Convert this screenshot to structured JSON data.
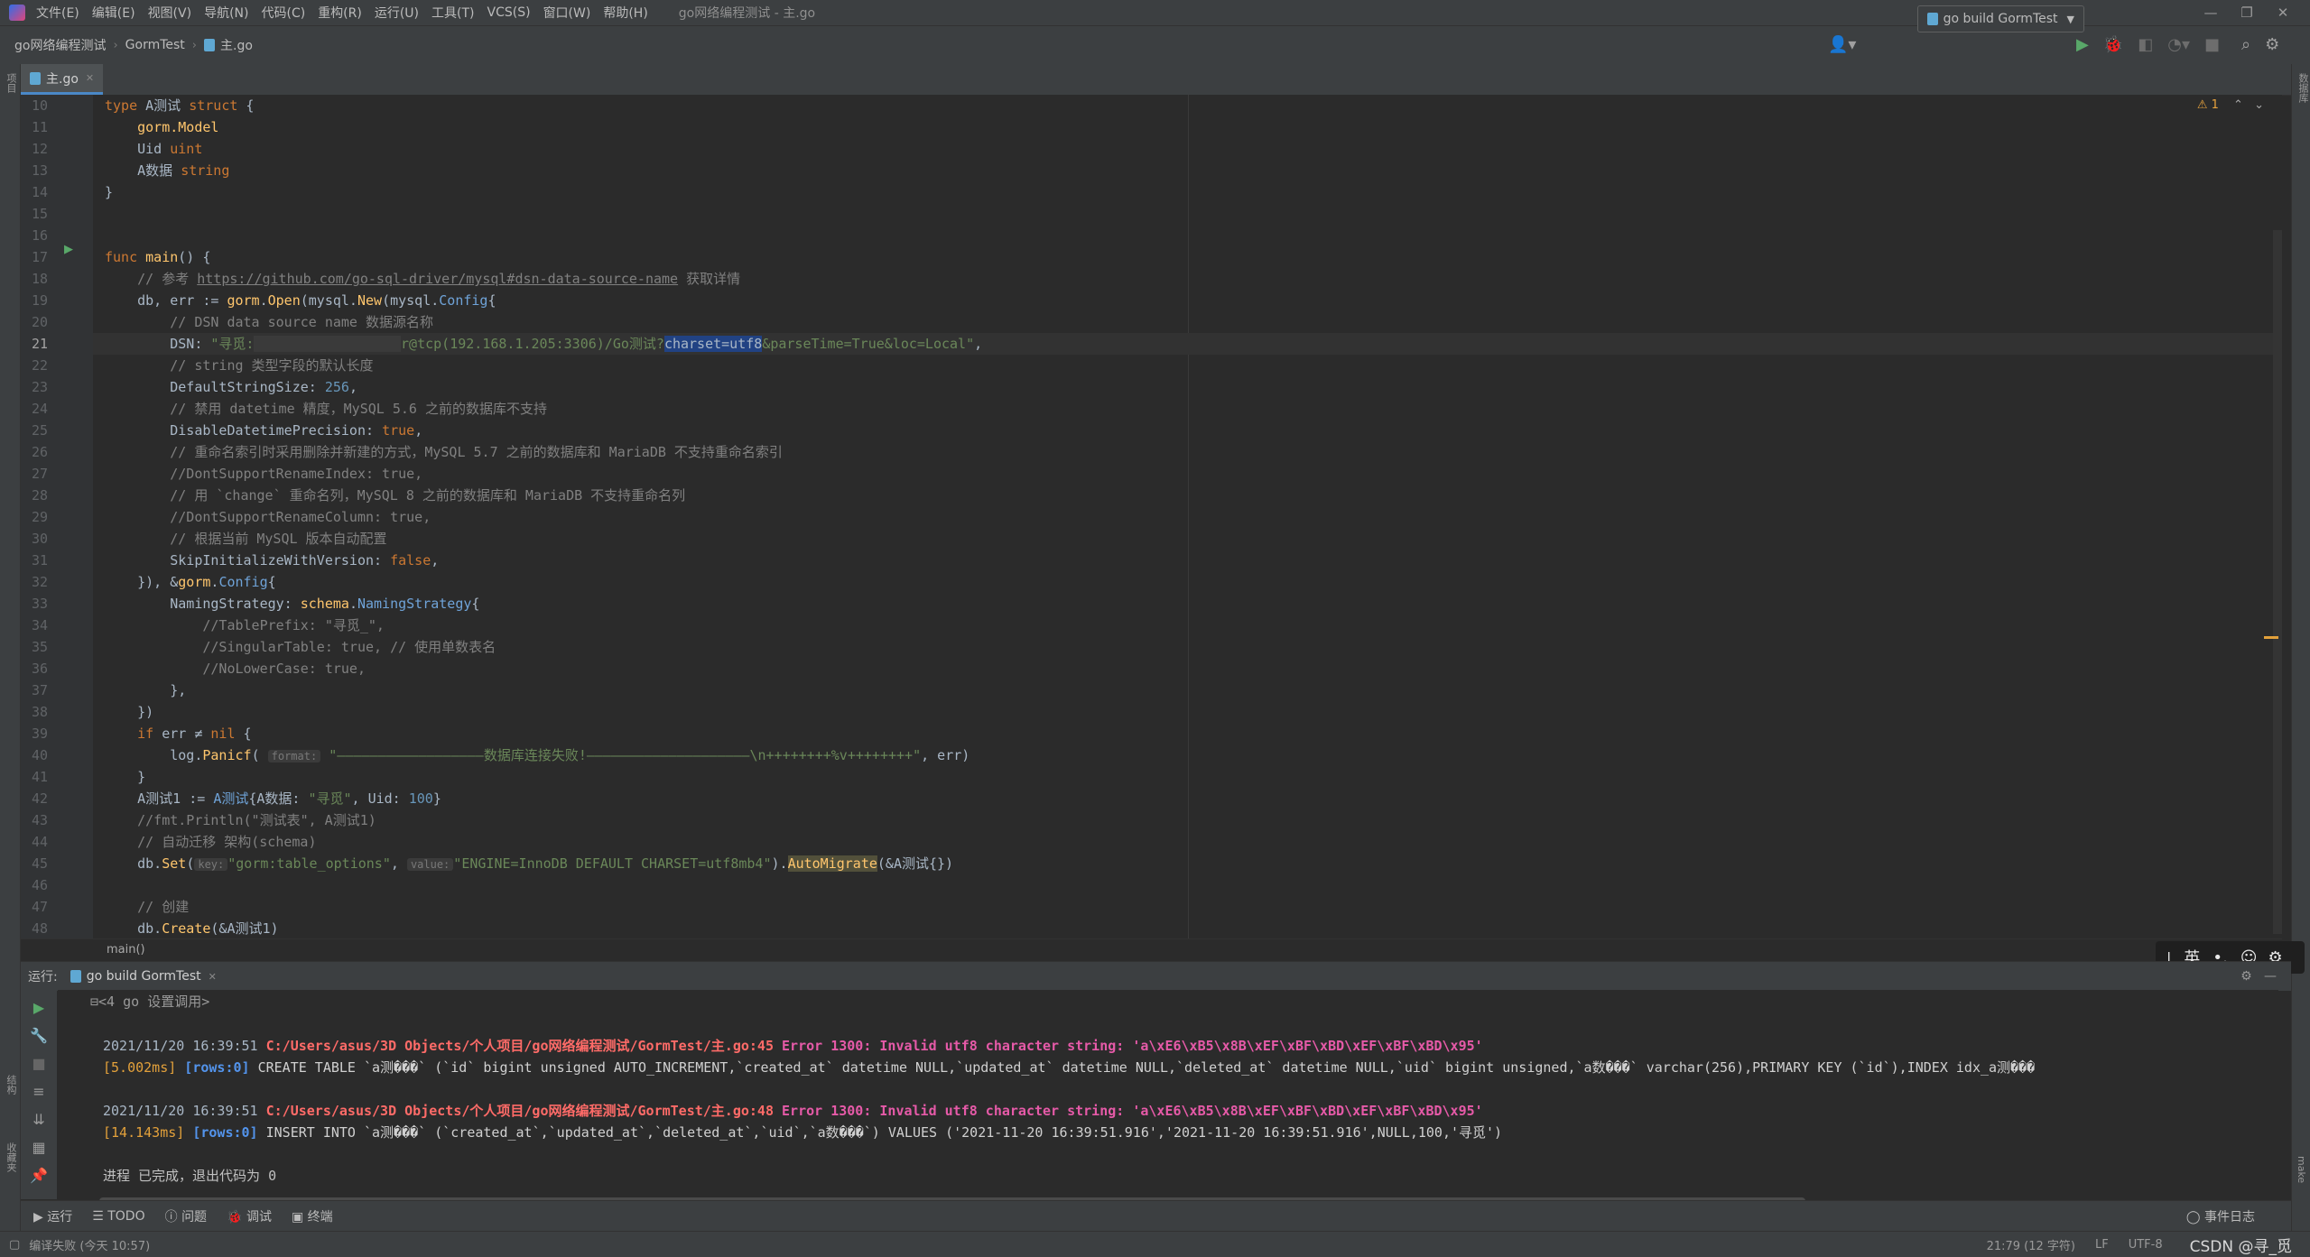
{
  "menu": {
    "items": [
      "文件(E)",
      "编辑(E)",
      "视图(V)",
      "导航(N)",
      "代码(C)",
      "重构(R)",
      "运行(U)",
      "工具(T)",
      "VCS(S)",
      "窗口(W)",
      "帮助(H)"
    ],
    "window_title": "go网络编程测试 - 主.go"
  },
  "nav": {
    "crumbs": [
      "go网络编程测试",
      "GormTest",
      "主.go"
    ],
    "run_config": "go build GormTest"
  },
  "editor": {
    "tab_label": "主.go",
    "warning_count": "1",
    "lines": [
      {
        "n": "10"
      },
      {
        "n": "11"
      },
      {
        "n": "12"
      },
      {
        "n": "13"
      },
      {
        "n": "14"
      },
      {
        "n": "15"
      },
      {
        "n": "16"
      },
      {
        "n": "17"
      },
      {
        "n": "18"
      },
      {
        "n": "19"
      },
      {
        "n": "20"
      },
      {
        "n": "21"
      },
      {
        "n": "22"
      },
      {
        "n": "23"
      },
      {
        "n": "24"
      },
      {
        "n": "25"
      },
      {
        "n": "26"
      },
      {
        "n": "27"
      },
      {
        "n": "28"
      },
      {
        "n": "29"
      },
      {
        "n": "30"
      },
      {
        "n": "31"
      },
      {
        "n": "32"
      },
      {
        "n": "33"
      },
      {
        "n": "34"
      },
      {
        "n": "35"
      },
      {
        "n": "36"
      },
      {
        "n": "37"
      },
      {
        "n": "38"
      },
      {
        "n": "39"
      },
      {
        "n": "40"
      },
      {
        "n": "41"
      },
      {
        "n": "42"
      },
      {
        "n": "43"
      },
      {
        "n": "44"
      },
      {
        "n": "45"
      },
      {
        "n": "46"
      },
      {
        "n": "47"
      },
      {
        "n": "48"
      }
    ],
    "code": {
      "l10": [
        "type",
        " A测试 ",
        "struct",
        " {"
      ],
      "l11": "gorm.Model",
      "l12a": "Uid ",
      "l12b": "uint",
      "l13a": "A数据 ",
      "l13b": "string",
      "l14": "}",
      "l17a": "func ",
      "l17b": "main",
      "l17c": "() {",
      "l18a": "// 参考 ",
      "l18b": "https://github.com/go-sql-driver/mysql#dsn-data-source-name",
      "l18c": " 获取详情",
      "l19a": "db, err := ",
      "l19b": "gorm",
      "l19c": ".",
      "l19d": "Open",
      "l19e": "(mysql.",
      "l19f": "New",
      "l19g": "(mysql.",
      "l19h": "Config",
      "l19i": "{",
      "l20": "// DSN data source name 数据源名称",
      "l21a": "DSN: ",
      "l21b": "\"寻觅:",
      "l21c": "                  ",
      "l21d": "r@tcp(192.168.1.205:3306)/Go测试?",
      "l21e": "charset=utf8",
      "l21f": "&parseTime=True&loc=Local\"",
      "l21g": ",",
      "l22": "// string 类型字段的默认长度",
      "l23a": "DefaultStringSize: ",
      "l23b": "256",
      "l23c": ",",
      "l24": "// 禁用 datetime 精度，MySQL 5.6 之前的数据库不支持",
      "l25a": "DisableDatetimePrecision: ",
      "l25b": "true",
      "l25c": ",",
      "l26": "// 重命名索引时采用删除并新建的方式，MySQL 5.7 之前的数据库和 MariaDB 不支持重命名索引",
      "l27": "//DontSupportRenameIndex: true,",
      "l28": "// 用 `change` 重命名列，MySQL 8 之前的数据库和 MariaDB 不支持重命名列",
      "l29": "//DontSupportRenameColumn: true,",
      "l30": "// 根据当前 MySQL 版本自动配置",
      "l31a": "SkipInitializeWithVersion: ",
      "l31b": "false",
      "l31c": ",",
      "l32a": "}), &",
      "l32b": "gorm",
      "l32c": ".",
      "l32d": "Config",
      "l32e": "{",
      "l33a": "NamingStrategy: ",
      "l33b": "schema",
      "l33c": ".",
      "l33d": "NamingStrategy",
      "l33e": "{",
      "l34": "//TablePrefix: \"寻觅_\",",
      "l35": "//SingularTable: true, // 使用单数表名",
      "l36": "//NoLowerCase: true,",
      "l37": "},",
      "l38": "})",
      "l39a": "if",
      "l39b": " err ≠ ",
      "l39c": "nil",
      "l39d": " {",
      "l40a": "log.",
      "l40b": "Panicf",
      "l40c": "(",
      "l40d": "format:",
      "l40e": "\"——————————————————数据库连接失败!————————————————————\\n++++++++%v++++++++\"",
      "l40f": ", err)",
      "l41": "}",
      "l42a": "A测试1 := ",
      "l42b": "A测试",
      "l42c": "{A数据: ",
      "l42d": "\"寻觅\"",
      "l42e": ", Uid: ",
      "l42f": "100",
      "l42g": "}",
      "l43": "//fmt.Println(\"测试表\", A测试1)",
      "l44": "// 自动迁移 架构(schema)",
      "l45a": "db.",
      "l45b": "Set",
      "l45c": "(",
      "l45d": "key:",
      "l45e": "\"gorm:table_options\"",
      "l45f": ", ",
      "l45g": "value:",
      "l45h": "\"ENGINE=InnoDB DEFAULT CHARSET=utf8mb4\"",
      "l45i": ").",
      "l45j": "AutoMigrate",
      "l45k": "(&A测试{})",
      "l47": "// 创建",
      "l48a": "db.",
      "l48b": "Create",
      "l48c": "(&A测试1)"
    },
    "breadcrumb_bottom": "main()"
  },
  "run_panel": {
    "label": "运行:",
    "tab": "go build GormTest",
    "fold_line": "<4 go 设置调用>",
    "log1_ts": "2021/11/20 16:39:51 ",
    "log1_path": "C:/Users/asus/3D Objects/个人项目/go网络编程测试/GormTest/主.go:45",
    "log1_err": " Error 1300: Invalid utf8 character string: 'a\\xE6\\xB5\\x8B\\xEF\\xBF\\xBD\\xEF\\xBF\\xBD\\x95'",
    "log1_time": "[5.002ms]",
    "log1_rows": " [rows:0]",
    "log1_sql": " CREATE TABLE `a测���` (`id` bigint unsigned AUTO_INCREMENT,`created_at` datetime NULL,`updated_at` datetime NULL,`deleted_at` datetime NULL,`uid` bigint unsigned,`a数���` varchar(256),PRIMARY KEY (`id`),INDEX idx_a测���",
    "log2_ts": "2021/11/20 16:39:51 ",
    "log2_path": "C:/Users/asus/3D Objects/个人项目/go网络编程测试/GormTest/主.go:48",
    "log2_err": " Error 1300: Invalid utf8 character string: 'a\\xE6\\xB5\\x8B\\xEF\\xBF\\xBD\\xEF\\xBF\\xBD\\x95'",
    "log2_time": "[14.143ms]",
    "log2_rows": " [rows:0]",
    "log2_sql": " INSERT INTO `a测���` (`created_at`,`updated_at`,`deleted_at`,`uid`,`a数���`) VALUES ('2021-11-20 16:39:51.916','2021-11-20 16:39:51.916',NULL,100,'寻觅')",
    "exit": "进程 已完成，退出代码为 0"
  },
  "bottom_tabs": [
    "运行",
    "TODO",
    "问题",
    "调试",
    "终端"
  ],
  "status": {
    "left": "编译失败 (今天 10:57)",
    "position": "21:79 (12 字符)",
    "line_sep": "LF",
    "encoding": "UTF-8",
    "event_log": "事件日志",
    "watermark": "CSDN @寻_觅"
  },
  "ime": {
    "lang": "英"
  },
  "side": {
    "left_top": "项目",
    "left_bottom_1": "结构",
    "left_bottom_2": "收藏夹",
    "right_top": "数据库",
    "right_bottom": "make"
  }
}
